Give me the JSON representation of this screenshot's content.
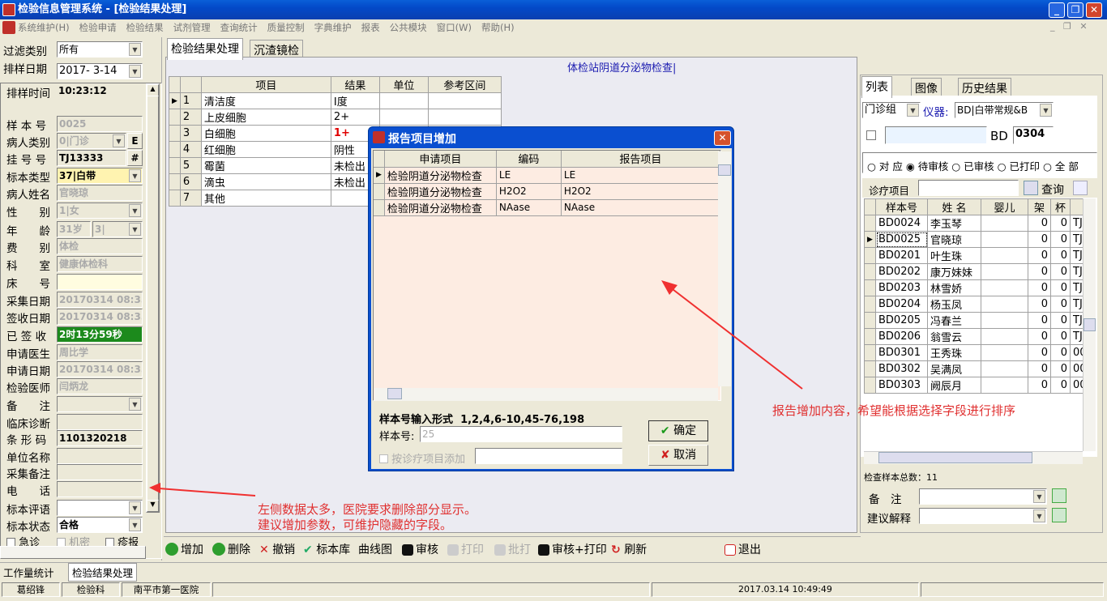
{
  "window": {
    "title": "检验信息管理系统 - [检验结果处理]"
  },
  "menu": [
    "系统维护(H)",
    "检验申请",
    "检验结果",
    "试剂管理",
    "查询统计",
    "质量控制",
    "字典维护",
    "报表",
    "公共模块",
    "窗口(W)",
    "帮助(H)"
  ],
  "left": {
    "filter_label": "过滤类别",
    "filter_value": "所有",
    "date_label": "排样日期",
    "date_value": "2017- 3-14",
    "time_label": "排样时间",
    "time_value": "10:23:12",
    "sample_no_label": "样 本 号",
    "sample_no_value": "0025",
    "patient_type_label": "病人类别",
    "patient_type_value": "0|门诊",
    "e_btn": "E",
    "reg_label": "挂 号 号",
    "reg_value": "TJ13333",
    "hash_btn": "#",
    "specimen_label": "标本类型",
    "specimen_value": "37|白带",
    "name_label": "病人姓名",
    "name_value": "官晓琼",
    "sex_label": "性　　别",
    "sex_value": "1|女",
    "age_label": "年　　龄",
    "age_value": "31岁",
    "age_unit": "3|",
    "fee_label": "费　　别",
    "fee_value": "体检",
    "dept_label": "科　　室",
    "dept_value": "健康体检科",
    "bed_label": "床　　号",
    "collect_label": "采集日期",
    "collect_value": "20170314 08:35",
    "receive_label": "签收日期",
    "receive_value": "20170314 08:35",
    "signed_label": "已 签 收",
    "signed_value": "2时13分59秒",
    "doctor_label": "申请医生",
    "doctor_value": "周比学",
    "apply_date_label": "申请日期",
    "apply_date_value": "20170314 08:35",
    "checker_label": "检验医师",
    "checker_value": "闫炳龙",
    "note_label": "备　　注",
    "diag_label": "临床诊断",
    "barcode_label": "条 形 码",
    "barcode_value": "1101320218",
    "unit_label": "单位名称",
    "collect_note_label": "采集备注",
    "phone_label": "电　　话",
    "eval_label": "标本评语",
    "status_label": "标本状态",
    "status_value": "合格",
    "urgent_label": "急诊",
    "secret_label": "机密",
    "disease_label": "疹报"
  },
  "tabs": [
    "检验结果处理",
    "沉渣镜检"
  ],
  "report_title": "体检站阴道分泌物检查|",
  "results": {
    "headers": [
      "项目",
      "结果",
      "单位",
      "参考区间"
    ],
    "rows": [
      {
        "n": "1",
        "item": "清洁度",
        "result": "Ⅰ度"
      },
      {
        "n": "2",
        "item": "上皮细胞",
        "result": "2+"
      },
      {
        "n": "3",
        "item": "白细胞",
        "result": "1+"
      },
      {
        "n": "4",
        "item": "红细胞",
        "result": "阴性"
      },
      {
        "n": "5",
        "item": "霉菌",
        "result": "未检出"
      },
      {
        "n": "6",
        "item": "滴虫",
        "result": "未检出"
      },
      {
        "n": "7",
        "item": "其他",
        "result": ""
      }
    ]
  },
  "dialog": {
    "title": "报告项目增加",
    "headers": [
      "申请项目",
      "编码",
      "报告项目"
    ],
    "rows": [
      {
        "apply": "检验阴道分泌物检查",
        "code": "LE",
        "report": "LE"
      },
      {
        "apply": "检验阴道分泌物检查",
        "code": "H2O2",
        "report": "H2O2"
      },
      {
        "apply": "检验阴道分泌物检查",
        "code": "NAase",
        "report": "NAase"
      }
    ],
    "format_label": "样本号输入形式",
    "format_value": "1,2,4,6-10,45-76,198",
    "sample_label": "样本号:",
    "sample_value": "25",
    "by_item_label": "按诊疗项目添加",
    "ok": "确定",
    "cancel": "取消"
  },
  "right": {
    "tabs": [
      "列表",
      "图像",
      "历史结果"
    ],
    "group_value": "门诊组",
    "instrument_label": "仪器:",
    "instrument_value": "BD|白带常规&B",
    "bd_label": "BD",
    "bd_value": "0304",
    "radios": [
      "对 应",
      "待审核",
      "已审核",
      "已打印",
      "全 部"
    ],
    "proj_label": "诊疗项目",
    "query_btn": "查询",
    "headers": [
      "样本号",
      "姓 名",
      "婴儿",
      "架",
      "杯",
      ""
    ],
    "rows": [
      {
        "no": "BD0024",
        "name": "李玉琴",
        "j": "0",
        "b": "0",
        "t": "TJ"
      },
      {
        "no": "BD0025",
        "name": "官晓琼",
        "j": "0",
        "b": "0",
        "t": "TJ"
      },
      {
        "no": "BD0201",
        "name": "叶生珠",
        "j": "0",
        "b": "0",
        "t": "TJ"
      },
      {
        "no": "BD0202",
        "name": "康万妹妹",
        "j": "0",
        "b": "0",
        "t": "TJ"
      },
      {
        "no": "BD0203",
        "name": "林雪娇",
        "j": "0",
        "b": "0",
        "t": "TJ"
      },
      {
        "no": "BD0204",
        "name": "杨玉凤",
        "j": "0",
        "b": "0",
        "t": "TJ"
      },
      {
        "no": "BD0205",
        "name": "冯春兰",
        "j": "0",
        "b": "0",
        "t": "TJ"
      },
      {
        "no": "BD0206",
        "name": "翁雪云",
        "j": "0",
        "b": "0",
        "t": "TJ"
      },
      {
        "no": "BD0301",
        "name": "王秀珠",
        "j": "0",
        "b": "0",
        "t": "00"
      },
      {
        "no": "BD0302",
        "name": "吴满凤",
        "j": "0",
        "b": "0",
        "t": "00"
      },
      {
        "no": "BD0303",
        "name": "阙辰月",
        "j": "0",
        "b": "0",
        "t": "00"
      }
    ],
    "total": "检查样本总数：11",
    "note_label": "备　注",
    "advice_label": "建议解释"
  },
  "toolbar": {
    "add": "增加",
    "delete": "删除",
    "undo": "撤销",
    "lib": "标本库",
    "curve": "曲线图",
    "audit": "审核",
    "print": "打印",
    "batch": "批打",
    "audit_print": "审核+打印",
    "refresh": "刷新",
    "exit": "退出"
  },
  "annotations": {
    "right_note": "报告增加内容，希望能根据选择字段进行排序",
    "left_note1": "左侧数据太多，医院要求删除部分显示。",
    "left_note2": "建议增加参数，可维护隐藏的字段。"
  },
  "bottom_tabs": [
    "工作量统计",
    "检验结果处理"
  ],
  "status": {
    "user": "葛绍锋",
    "dept": "检验科",
    "hospital": "南平市第一医院",
    "datetime": "2017.03.14 10:49:49"
  },
  "colors": {
    "title": "#0349c8",
    "dialog_bg": "#fdece2",
    "red_note": "#e03030",
    "signed_bg": "#1c8a1c"
  }
}
